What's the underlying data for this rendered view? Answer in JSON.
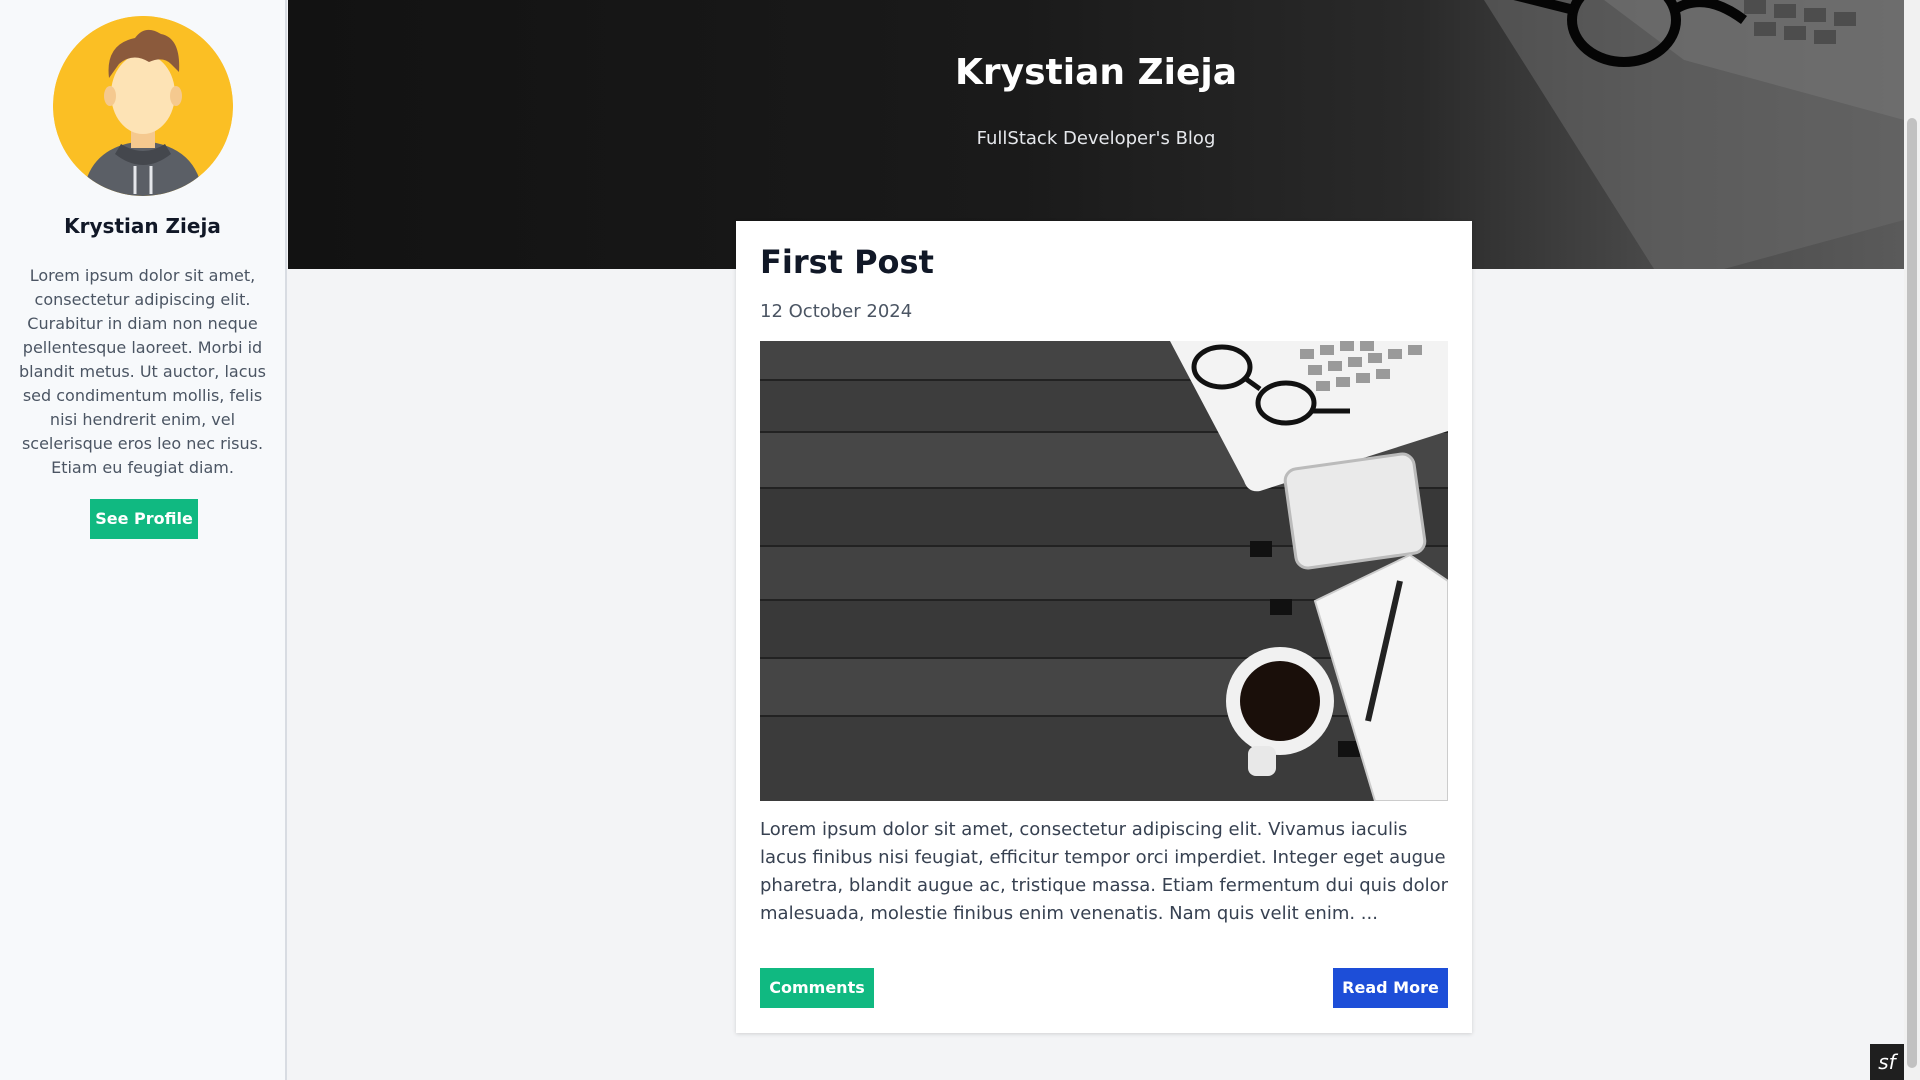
{
  "sidebar": {
    "name": "Krystian Zieja",
    "bio": "Lorem ipsum dolor sit amet, consectetur adipiscing elit. Curabitur in diam non neque pellentesque laoreet. Morbi id blandit metus. Ut auctor, lacus sed condimentum mollis, felis nisi hendrerit enim, vel scelerisque eros leo nec risus. Etiam eu feugiat diam.",
    "profile_button": "See Profile",
    "avatar_icon": "user-avatar-icon"
  },
  "header": {
    "title": "Krystian Zieja",
    "subtitle": "FullStack Developer's Blog"
  },
  "post": {
    "title": "First Post",
    "date": "12 October 2024",
    "excerpt": "Lorem ipsum dolor sit amet, consectetur adipiscing elit. Vivamus iaculis lacus finibus nisi feugiat, efficitur tempor orci imperdiet. Integer eget augue pharetra, blandit augue ac, tristique massa. Etiam fermentum dui quis dolor malesuada, molestie finibus enim venenatis. Nam quis velit enim. ...",
    "comments_button": "Comments",
    "read_more_button": "Read More"
  },
  "toolbar": {
    "badge_icon": "symfony-icon",
    "badge_glyph": "sf"
  },
  "colors": {
    "green": "#10b981",
    "blue": "#1d4ed8",
    "avatar_bg": "#fbbf24"
  }
}
